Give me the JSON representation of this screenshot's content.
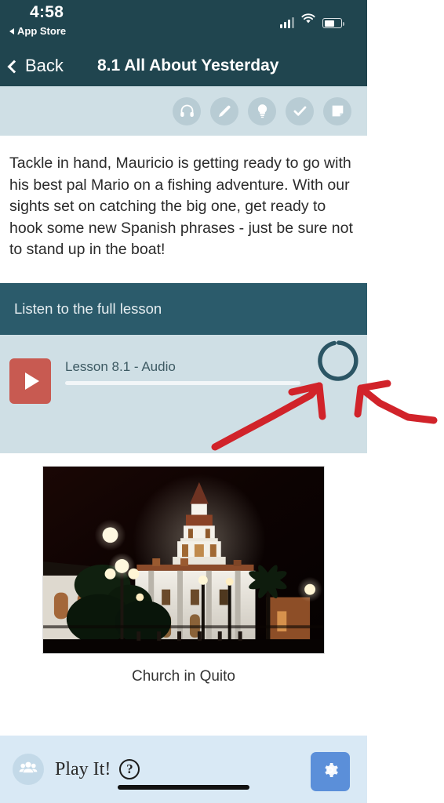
{
  "status_bar": {
    "time": "4:58",
    "return_app_label": "App Store",
    "return_arrow_icon": "back-triangle-icon",
    "signal_icon": "cellular-signal-icon",
    "signal_bars_filled": 3,
    "signal_bars_total": 4,
    "wifi_icon": "wifi-icon",
    "battery_icon": "battery-icon",
    "battery_percent": 62
  },
  "nav_bar": {
    "back_label": "Back",
    "back_icon": "chevron-left-icon",
    "title": "8.1 All About Yesterday"
  },
  "toolbar": {
    "items": [
      {
        "name": "headphones-icon",
        "label": "Listen"
      },
      {
        "name": "pencil-icon",
        "label": "Write"
      },
      {
        "name": "lightbulb-icon",
        "label": "Hint"
      },
      {
        "name": "check-icon",
        "label": "Check"
      },
      {
        "name": "note-icon",
        "label": "Notes"
      }
    ]
  },
  "intro": {
    "paragraph": "Tackle in hand, Mauricio is getting ready to go with his best pal Mario on a fishing adventure. With our sights set on catching the big one, get ready to hook some new Spanish phrases - just be sure not to stand up in the boat!"
  },
  "audio": {
    "section_title": "Listen to the full lesson",
    "play_icon": "play-icon",
    "track_title": "Lesson 8.1 - Audio",
    "progress_percent": 0,
    "spinner_icon": "loading-spinner-icon",
    "spinner_label": "Loading"
  },
  "figure": {
    "image_alt": "night-photo-of-illuminated-white-church-with-bell-tower",
    "caption": "Church in Quito"
  },
  "bottom_bar": {
    "people_icon": "people-group-icon",
    "play_it_label": "Play It!",
    "help_icon": "question-mark-icon",
    "settings_icon": "gear-icon",
    "home_indicator": "home-indicator-bar"
  },
  "annotation": {
    "arrows": [
      {
        "name": "red-arrow-left",
        "points_to": "loading-spinner-icon"
      },
      {
        "name": "red-arrow-right",
        "points_to": "loading-spinner-icon"
      }
    ],
    "color": "#d1232a"
  },
  "colors": {
    "navbar_bg": "#20454f",
    "toolbar_bg": "#cfdfe5",
    "audio_header_bg": "#2b5b6b",
    "audio_body_bg": "#cfdfe5",
    "play_button_bg": "#c85a51",
    "bottom_bar_bg": "#d9e9f5",
    "gear_button_bg": "#5b8fd9",
    "spinner_stroke": "#2b5564",
    "annotation_red": "#d1232a"
  }
}
